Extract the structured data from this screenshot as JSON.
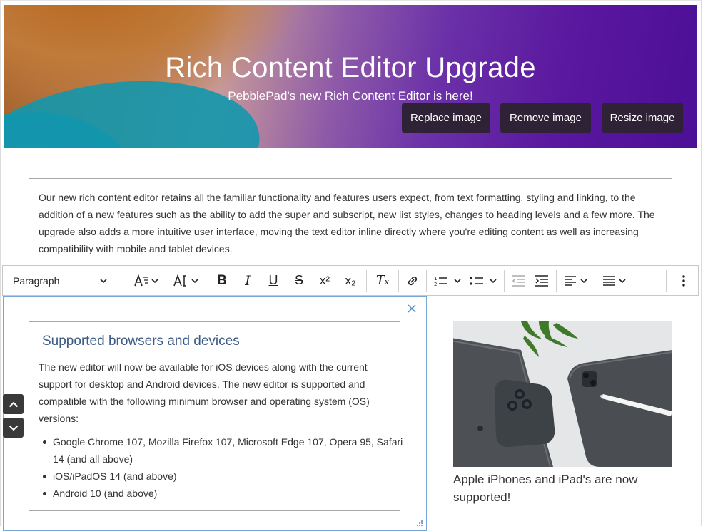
{
  "banner": {
    "title": "Rich Content Editor Upgrade",
    "subtitle": "PebblePad's new Rich Content Editor is here!",
    "buttons": {
      "replace": "Replace image",
      "remove": "Remove image",
      "resize": "Resize image"
    }
  },
  "intro": {
    "text": "Our new rich content editor retains all the familiar functionality and features users expect, from text formatting, styling and linking, to the addition of a new features such as the ability to add the super and subscript, new list styles, changes to heading levels and a few more. The upgrade also adds a more intuitive user interface, moving the text editor inline directly where you're editing content as well as increasing compatibility with mobile and tablet devices."
  },
  "toolbar": {
    "block_format": "Paragraph",
    "icons": [
      "font-family-icon",
      "font-size-icon",
      "bold-icon",
      "italic-icon",
      "underline-icon",
      "strikethrough-icon",
      "superscript-icon",
      "subscript-icon",
      "clear-formatting-icon",
      "link-icon",
      "numbered-list-icon",
      "bulleted-list-icon",
      "outdent-icon",
      "indent-icon",
      "align-icon",
      "line-height-icon",
      "more-options-icon"
    ]
  },
  "card": {
    "title": "Supported browsers and devices",
    "body": "The new editor will now be available for iOS devices along with the current support for desktop and Android devices. The new editor is supported and compatible with the following minimum browser and operating system (OS) versions:",
    "list": [
      "Google Chrome 107, Mozilla Firefox 107, Microsoft Edge 107, Opera 95, Safari 14 (and all above)",
      "iOS/iPadOS 14 (and above)",
      "Android 10 (and above)"
    ]
  },
  "image_block": {
    "caption": "Apple iPhones and iPad's are now supported!"
  },
  "colors": {
    "button_bg": "#2f2236",
    "card_title": "#3c5b84",
    "block_border": "#78a7d6"
  }
}
